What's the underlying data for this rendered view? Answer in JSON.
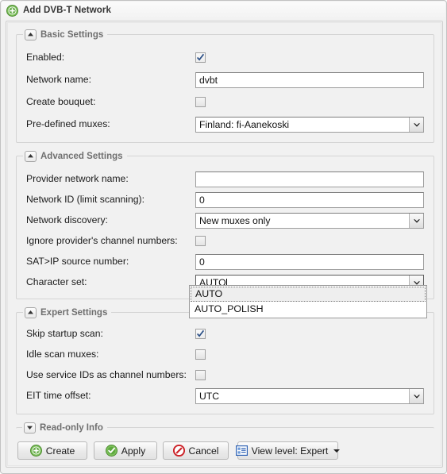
{
  "window": {
    "title": "Add DVB-T Network",
    "title_icon": "add-circle-green-icon"
  },
  "sections": {
    "basic": {
      "title": "Basic Settings",
      "toggle_icon": "chevron-up-icon",
      "expanded": true
    },
    "advanced": {
      "title": "Advanced Settings",
      "toggle_icon": "chevron-up-icon",
      "expanded": true
    },
    "expert": {
      "title": "Expert Settings",
      "toggle_icon": "chevron-up-icon",
      "expanded": true
    },
    "readonly": {
      "title": "Read-only Info",
      "toggle_icon": "chevron-down-icon",
      "expanded": false
    }
  },
  "fields": {
    "enabled": {
      "label": "Enabled:",
      "checked": true
    },
    "network_name": {
      "label": "Network name:",
      "value": "dvbt",
      "placeholder": ""
    },
    "create_bouquet": {
      "label": "Create bouquet:",
      "checked": false
    },
    "predefined_muxes": {
      "label": "Pre-defined muxes:",
      "value": "Finland: fi-Aanekoski"
    },
    "provider_network_name": {
      "label": "Provider network name:",
      "value": "",
      "placeholder": ""
    },
    "network_id": {
      "label": "Network ID (limit scanning):",
      "value": "0",
      "placeholder": ""
    },
    "network_discovery": {
      "label": "Network discovery:",
      "value": "New muxes only"
    },
    "ignore_provider_channel_numbers": {
      "label": "Ignore provider's channel numbers:",
      "checked": false
    },
    "satip_source_number": {
      "label": "SAT>IP source number:",
      "value": "0",
      "placeholder": ""
    },
    "character_set": {
      "label": "Character set:",
      "value": "AUTO",
      "open": true,
      "options": [
        "AUTO",
        "AUTO_POLISH"
      ],
      "selected_index": 0
    },
    "skip_startup_scan": {
      "label": "Skip startup scan:",
      "checked": true
    },
    "idle_scan_muxes": {
      "label": "Idle scan muxes:",
      "checked": false
    },
    "use_service_ids": {
      "label": "Use service IDs as channel numbers:",
      "checked": false
    },
    "eit_time_offset": {
      "label": "EIT time offset:",
      "value": "UTC"
    }
  },
  "buttons": {
    "create": {
      "label": "Create",
      "icon": "add-circle-green-icon"
    },
    "apply": {
      "label": "Apply",
      "icon": "check-circle-green-icon"
    },
    "cancel": {
      "label": "Cancel",
      "icon": "no-entry-red-icon"
    },
    "view_level": {
      "label": "View level: Expert",
      "icon": "list-blue-icon",
      "menu_icon": "caret-down-icon"
    }
  },
  "colors": {
    "accent_green": "#5ea83f",
    "accent_red": "#cc2127",
    "accent_blue": "#2f62b5",
    "panel_bg": "#f1f1f1",
    "field_border": "#9c9c9c",
    "legend_text": "#6f6f6f"
  }
}
